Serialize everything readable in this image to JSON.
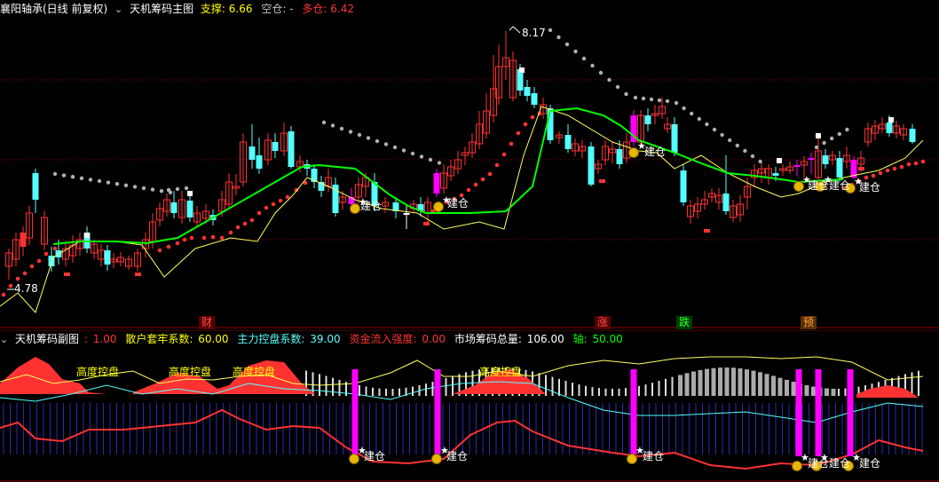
{
  "main": {
    "stock_name": "襄阳轴承(日线 前复权)",
    "indicator_title": "天机筹码主图",
    "support_label": "支撑:",
    "support_value": "6.66",
    "empty_label": "空仓:",
    "empty_value": "-",
    "long_label": "多仓:",
    "long_value": "6.42",
    "high_price": "8.17",
    "low_price": "4.78",
    "build_label": "建仓"
  },
  "sub": {
    "title": "天机筹码副图",
    "p1_label": ":",
    "p1_value": "1.00",
    "p2_label": "散户套牢系数:",
    "p2_value": "60.00",
    "p3_label": "主力控盘系数:",
    "p3_value": "39.00",
    "p4_label": "资金流入强度:",
    "p4_value": "0.00",
    "p5_label": "市场筹码总量:",
    "p5_value": "106.00",
    "p6_label": "轴:",
    "p6_value": "50.00",
    "control_label": "高度控盘",
    "build_label": "建仓"
  },
  "badges": {
    "cai": "财",
    "zhang": "涨",
    "die": "跌",
    "yu": "预"
  },
  "colors": {
    "up": "#ff3232",
    "down": "#54ffff",
    "magenta": "#ff00ff",
    "green": "#00ff00",
    "yellow": "#ffff00",
    "gray": "#b0b0b0"
  },
  "icons": [
    "circle-chevron-icon",
    "money-bag-icon",
    "star-icon"
  ]
}
